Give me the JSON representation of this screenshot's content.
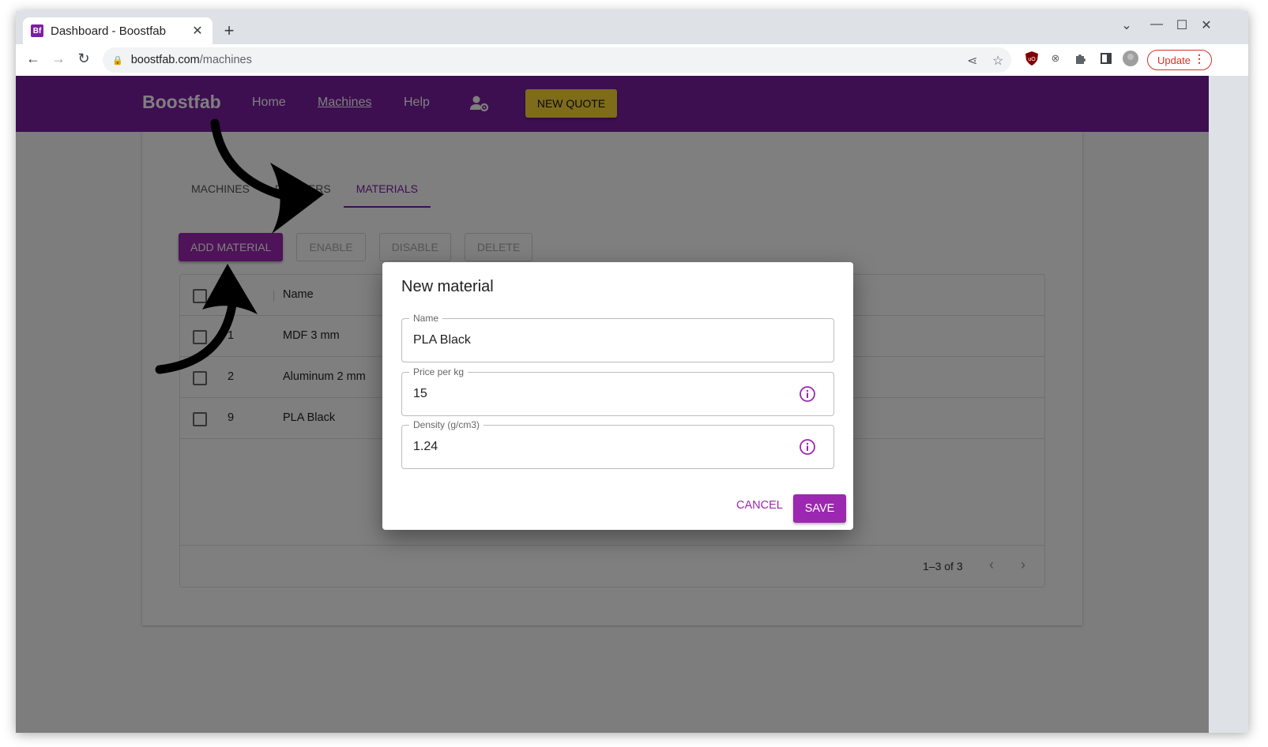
{
  "browser": {
    "tab_title": "Dashboard - Boostfab",
    "favicon_text": "Bf",
    "url_host": "boostfab.com",
    "url_path": "/machines",
    "update_label": "Update"
  },
  "appbar": {
    "brand": "Boostfab",
    "nav": [
      "Home",
      "Machines",
      "Help"
    ],
    "new_quote": "NEW QUOTE",
    "accent": "#7b1fa2",
    "quote_color": "#fdd835"
  },
  "page": {
    "tabs": [
      "MACHINES",
      "PRINTERS",
      "MATERIALS"
    ],
    "actions": {
      "add": "ADD MATERIAL",
      "enable": "ENABLE",
      "disable": "DISABLE",
      "delete": "DELETE"
    },
    "table": {
      "header_name": "Name",
      "rows": [
        {
          "id": "1",
          "name": "MDF 3 mm"
        },
        {
          "id": "2",
          "name": "Aluminum 2 mm"
        },
        {
          "id": "9",
          "name": "PLA Black"
        }
      ],
      "pagination": "1–3 of 3"
    }
  },
  "dialog": {
    "title": "New material",
    "name_label": "Name",
    "name_value": "PLA Black",
    "price_label": "Price per kg",
    "price_value": "15",
    "density_label": "Density (g/cm3)",
    "density_value": "1.24",
    "cancel": "CANCEL",
    "save": "SAVE"
  }
}
